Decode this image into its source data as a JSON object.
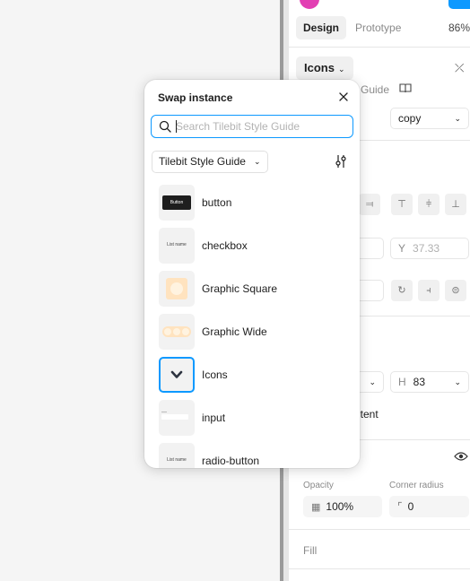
{
  "panel": {
    "tabs": [
      "Design",
      "Prototype"
    ],
    "zoom": "86%",
    "component_name": "Icons",
    "library_label": "Guide",
    "property_value": "copy",
    "position": {
      "y_label": "Y",
      "y_value": "37.33"
    },
    "size": {
      "h_label": "H",
      "h_value": "83"
    },
    "content_label": "ntent",
    "opacity_label": "Opacity",
    "opacity_value": "100%",
    "corner_label": "Corner radius",
    "corner_value": "0",
    "fill_label": "Fill"
  },
  "popup": {
    "title": "Swap instance",
    "search_placeholder": "Search Tilebit Style Guide",
    "library_select": "Tilebit Style Guide",
    "items": [
      {
        "label": "button",
        "thumb_text": "Button"
      },
      {
        "label": "checkbox",
        "thumb_text": "List name"
      },
      {
        "label": "Graphic Square"
      },
      {
        "label": "Graphic Wide"
      },
      {
        "label": "Icons",
        "selected": true
      },
      {
        "label": "input"
      },
      {
        "label": "radio-button",
        "thumb_text": "List name"
      }
    ]
  },
  "colors": {
    "accent": "#0d99ff",
    "avatar": "#e23fb3",
    "graphic_fill": "#ffe3bf"
  },
  "icons": [
    "close-icon",
    "search-icon",
    "filter-icon",
    "chevron-down-icon",
    "eye-icon",
    "book-icon",
    "detach-icon"
  ]
}
